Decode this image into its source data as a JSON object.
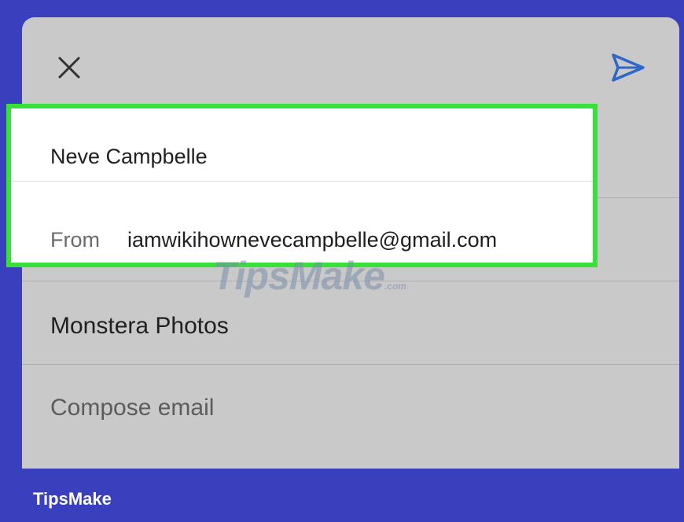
{
  "compose": {
    "to_value": "Neve Campbelle",
    "from_label": "From",
    "from_value": "iamwikihownevecampbelle@gmail.com",
    "subject_value": "Monstera Photos",
    "body_placeholder": "Compose email"
  },
  "toolbar": {
    "close_icon": "close-icon",
    "send_icon": "send-icon"
  },
  "watermark": {
    "text": "TipsMake",
    "suffix": ".com"
  },
  "footer": {
    "brand": "TipsMake"
  },
  "colors": {
    "frame": "#3a3fbd",
    "sheet": "#c9c9c9",
    "highlight_border": "#38e03a",
    "send_icon": "#2f66c9"
  }
}
